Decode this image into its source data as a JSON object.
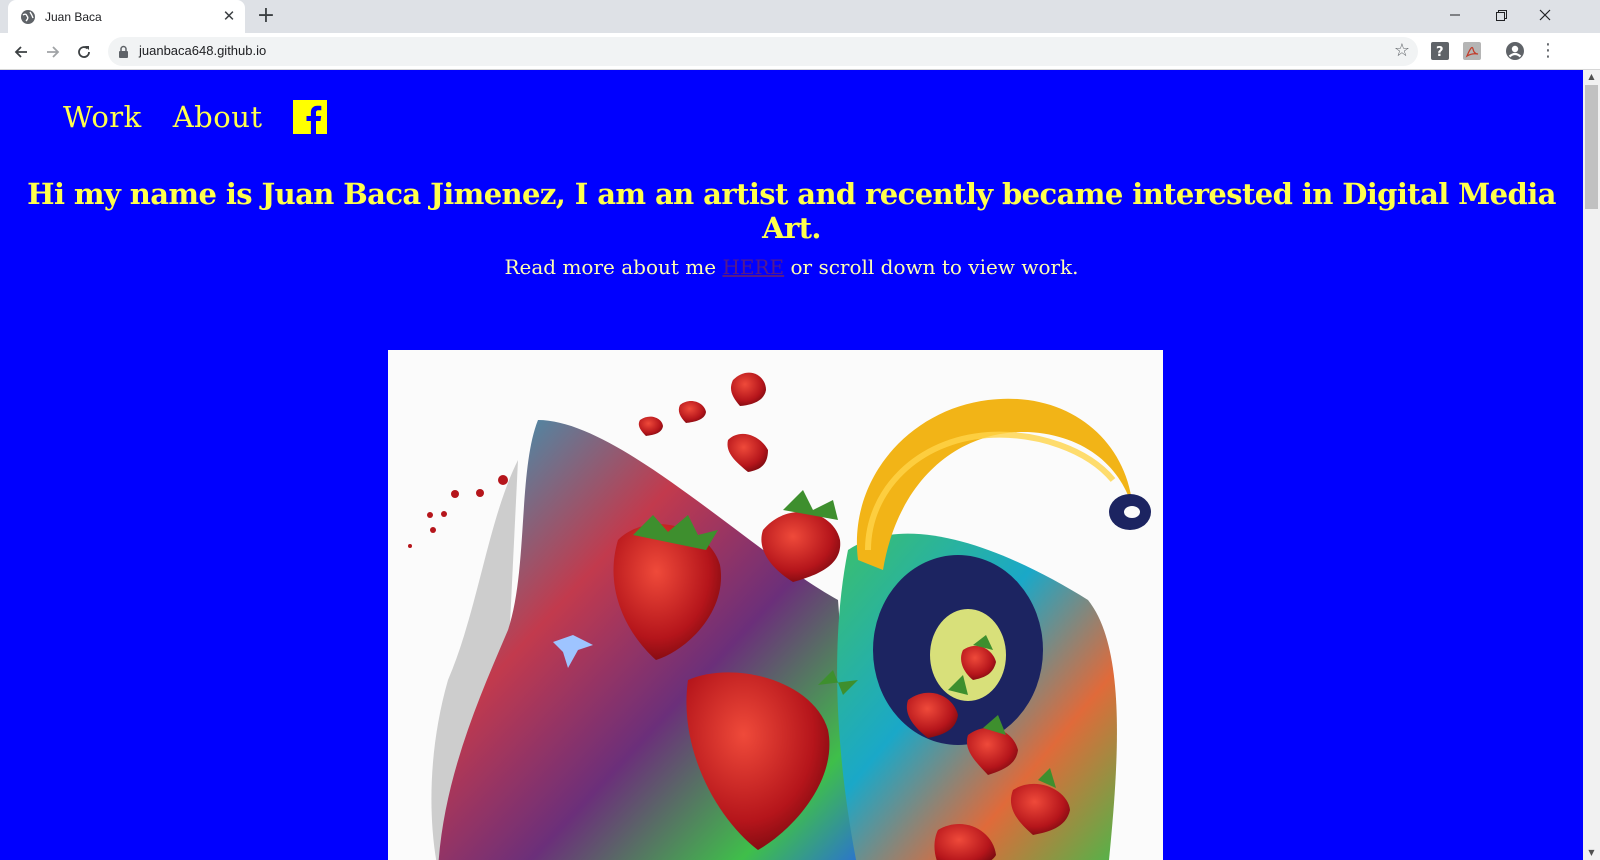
{
  "browser": {
    "tab_title": "Juan Baca",
    "url": "juanbaca648.github.io",
    "icons": [
      "globe-icon",
      "close-icon",
      "plus-icon",
      "back-arrow-icon",
      "forward-arrow-icon",
      "reload-icon",
      "lock-icon",
      "star-icon",
      "help-extension-icon",
      "pdf-extension-icon",
      "profile-icon",
      "menu-dots-icon",
      "minimize-icon",
      "restore-icon",
      "window-close-icon"
    ]
  },
  "page": {
    "background": "#0000ff",
    "accent": "#ffff4d",
    "nav": {
      "work": "Work",
      "about": "About",
      "facebook_icon": "facebook-icon"
    },
    "headline": "Hi my name is Juan Baca Jimenez, I am an artist and recently became interested in Digital Media Art.",
    "subline": {
      "before": "Read more about me ",
      "link": "HERE",
      "after": " or scroll down to view work."
    },
    "artwork_description_icon": "artwork-image"
  }
}
